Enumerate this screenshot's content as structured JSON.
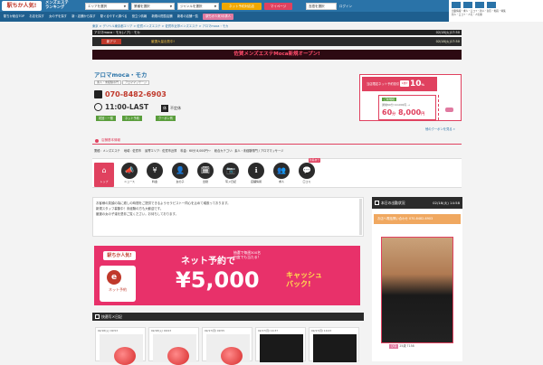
{
  "header": {
    "logo": "駅ちか人気!",
    "ranking_title": "メンズエステ\nランキング",
    "area_select": "エリアを選択",
    "region_select": "業種を選択",
    "genre_select": "ジャンルを選択",
    "yoyaku_button": "ネット予約対応店",
    "mypage_button": "マイページ",
    "lang_select": "言語を選択",
    "login_label": "ログイン"
  },
  "right_nav": {
    "links": "出勤情報・求人・口コミ・新人・割引・動画・特集",
    "links2": "新人・口コミ・人気・人気順"
  },
  "nav2": {
    "items": [
      "駅ちか総合TOP",
      "お店を探す",
      "女の子を探す",
      "新・店舗から探す",
      "駅ぐるやすぐ調べる",
      "役立つ情報",
      "新規の閲覧店舗",
      "新着の店舗一覧",
      "一般求人情報"
    ],
    "pink_label": "駅ちか人気!の求人"
  },
  "breadcrumb": "東京 > デリヘル東京都エリア > 佐賀メンズエステ > 佐賀市近郊メンズエステ > アロマmoca・モカ",
  "shop_bar": {
    "left": "アロマmoca・モカ(ノア) · モカ",
    "right": "02/18(火)17:50"
  },
  "cat_bar": {
    "tag": "新アツ",
    "note": "厳選大量出勤中!",
    "right": "02/18(火)17:50"
  },
  "banner": "佐賀メンズエステMoca新規オープン!",
  "shop": {
    "name": "アロマmoca・モカ",
    "pills": [
      "素人・未経験専門",
      "アロママッサージ"
    ],
    "phone": "070-8482-6903",
    "hours": "11:00-LAST",
    "holiday_icon_label": "休",
    "holiday": "不定休",
    "tags": [
      "初回・一般",
      "ネット予約",
      "クーポン有"
    ]
  },
  "coupon": {
    "title": "当店限定ネット予約割引",
    "tp_label": "1枚P",
    "discount": "10",
    "discount_unit": "%",
    "inner_label": "ご新規様",
    "price_line": "通常60分 10,000円 →",
    "price_minutes": "60",
    "price_minutes_unit": "分",
    "price": "8,000",
    "price_unit": "円"
  },
  "more_coupons": "他のクーポンを見る »",
  "info": {
    "heading": "店舗基本情報",
    "line": "業種：メンズエステ　 地域：佐賀市　 最寄エリア：佐賀市近郊　 料金：60分 8,000円～　 総合カテゴリ：素人・未経験専門 / アロママッサージ"
  },
  "tabs": [
    {
      "label": "トップ",
      "glyph": "⌂"
    },
    {
      "label": "ニュース",
      "glyph": "📣"
    },
    {
      "label": "料金",
      "glyph": "¥"
    },
    {
      "label": "女の子",
      "glyph": "👤"
    },
    {
      "label": "出勤",
      "glyph": "🗓"
    },
    {
      "label": "写メ日記",
      "glyph": "📷"
    },
    {
      "label": "店舗情報",
      "glyph": "ℹ"
    },
    {
      "label": "求人",
      "glyph": "👥"
    },
    {
      "label": "口コミ",
      "glyph": "💬"
    }
  ],
  "new_badge": "新着あり",
  "description": "お客様の笑顔の為に癒しの時間をご提供できるようセラピスト一同心を込めて頑張っております。\n新規スタッフ募集中！未経験の方も大歓迎です。\n厳選の女の子達を是非ご覧ください。お待ちしております。",
  "ad": {
    "logo": "駅ちか人気!",
    "phone_label": "ネット予約",
    "text1": "ネット予約で",
    "text2": "抽選で毎週300名\n何度でも当たる！",
    "amount": "¥5,000",
    "cash": "キャッシュ\nバック!"
  },
  "diary": {
    "heading": "快適写メ日記",
    "items": [
      "02/18(火) 09:53",
      "02/18(火) 09:03",
      "02/17(月) 09:55",
      "02/17(月) 14:37",
      "02/17(月) 10:23"
    ]
  },
  "sidebar": {
    "heading": "本日の出勤状況",
    "date": "02/18(火) 14:58",
    "button": "お店へ電話問い合わせ 070-8482-6903",
    "girl_name": "ひな",
    "girl_meta": "25歳 T158"
  },
  "colors": {
    "accent": "#e0415f",
    "blue": "#2a73a8",
    "dark": "#2b2b2b"
  }
}
